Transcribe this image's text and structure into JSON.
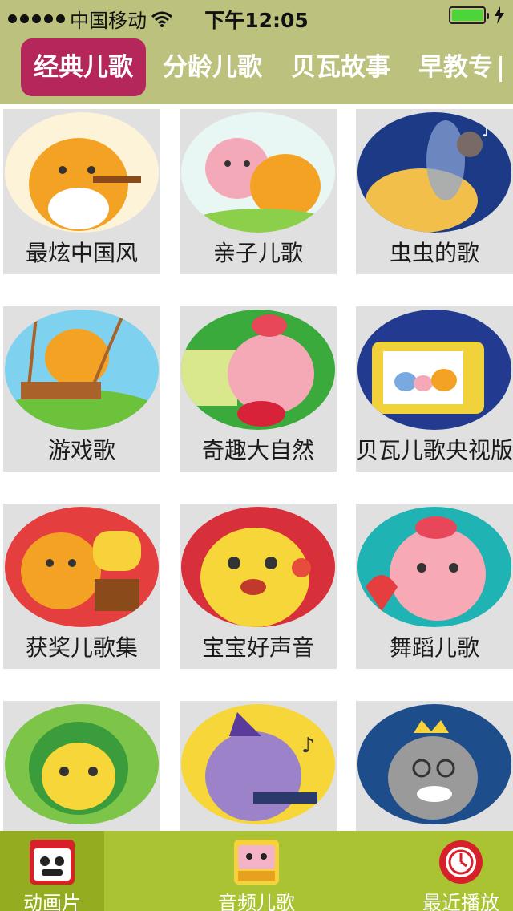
{
  "status_bar": {
    "carrier": "中国移动",
    "time": "下午12:05"
  },
  "top_tabs": [
    "经典儿歌",
    "分龄儿歌",
    "贝瓦故事",
    "早教专"
  ],
  "categories": [
    {
      "label": "最炫中国风",
      "bg": "#fdf3d8",
      "char": "#f4a223"
    },
    {
      "label": "亲子儿歌",
      "bg": "#e9f7f4",
      "char": "#f4a9b8"
    },
    {
      "label": "虫虫的歌",
      "bg": "#1d3a86",
      "char": "#f2c04a"
    },
    {
      "label": "游戏歌",
      "bg": "#7ed2f0",
      "char": "#f4a223"
    },
    {
      "label": "奇趣大自然",
      "bg": "#3aaa3c",
      "char": "#f5a9b7"
    },
    {
      "label": "贝瓦儿歌央视版",
      "bg": "#223a8f",
      "char": "#f2d23a"
    },
    {
      "label": "获奖儿歌集",
      "bg": "#e53e3e",
      "char": "#f4a223"
    },
    {
      "label": "宝宝好声音",
      "bg": "#d8303a",
      "char": "#f7d63a"
    },
    {
      "label": "舞蹈儿歌",
      "bg": "#1fb3b3",
      "char": "#f7a9b5"
    },
    {
      "label": "",
      "bg": "#7cc548",
      "char": "#f7d63a"
    },
    {
      "label": "",
      "bg": "#f7d63a",
      "char": "#9b82c9"
    },
    {
      "label": "",
      "bg": "#1d4d8a",
      "char": "#9a9a9a"
    }
  ],
  "bottom_tabs": [
    {
      "label": "动画片",
      "icon": "cartoon-tv-icon"
    },
    {
      "label": "音频儿歌",
      "icon": "music-box-icon"
    },
    {
      "label": "最近播放",
      "icon": "recent-clock-icon"
    }
  ],
  "colors": {
    "header": "#bcc27e",
    "active_tab": "#b5265a",
    "bottom_bar": "#a9c332"
  }
}
